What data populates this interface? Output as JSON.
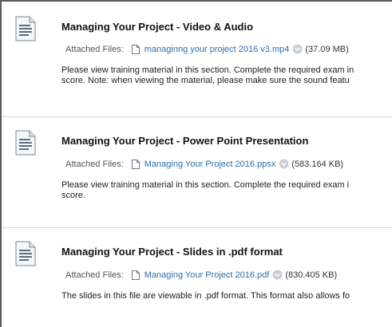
{
  "items": [
    {
      "title": "Managing Your Project - Video & Audio",
      "attached_label": "Attached Files:",
      "file_name": "managinng your project 2016 v3.mp4",
      "file_size": "(37.09 MB)",
      "desc_line1": "Please view training material in this section. Complete the required exam in",
      "desc_line2": "score. Note: when viewing the material, please make sure the sound featu"
    },
    {
      "title": "Managing Your Project - Power Point Presentation",
      "attached_label": "Attached Files:",
      "file_name": "Managing Your Project 2016.ppsx",
      "file_size": "(583.164 KB)",
      "desc_line1": "Please view training material in this section. Complete the required exam i",
      "desc_line2": "score."
    },
    {
      "title": "Managing Your Project - Slides in .pdf format",
      "attached_label": "Attached Files:",
      "file_name": "Managing Your Project 2016.pdf",
      "file_size": "(830.405 KB)",
      "desc_line1": "The slides in this file are viewable in .pdf format. This format also allows fo",
      "desc_line2": ""
    }
  ],
  "icons": {
    "item_icon": "document-icon",
    "file_icon": "file-icon",
    "options_icon": "chevron-down-circle-icon"
  },
  "colors": {
    "link": "#2a6fb0",
    "divider": "#d9d9d9"
  }
}
